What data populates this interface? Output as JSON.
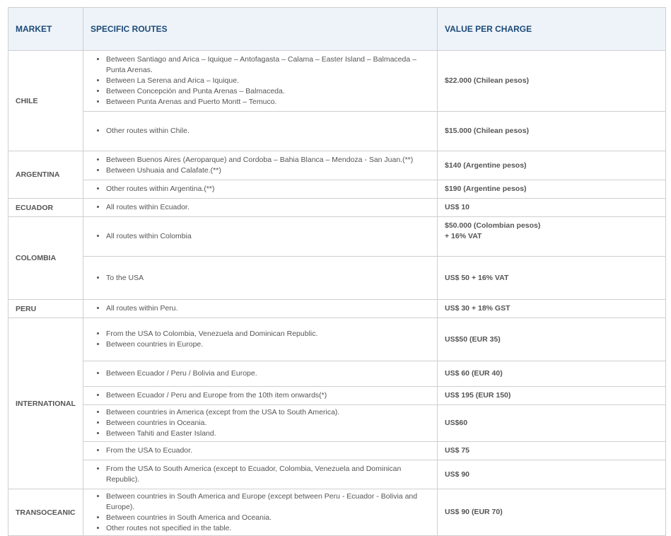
{
  "table": {
    "headers": {
      "market": "MARKET",
      "routes": "SPECIFIC ROUTES",
      "value": "VALUE PER CHARGE"
    },
    "markets": [
      {
        "name": "CHILE",
        "groups": [
          {
            "routes": [
              "Between Santiago and Arica – Iquique – Antofagasta – Calama – Easter Island – Balmaceda – Punta Arenas.",
              "Between La Serena and Arica – Iquique.",
              "Between Concepción and Punta Arenas – Balmaceda.",
              "Between Punta Arenas and Puerto Montt – Temuco."
            ],
            "value": [
              "$22.000 (Chilean pesos)"
            ]
          },
          {
            "routes": [
              "Other routes within Chile."
            ],
            "value": [
              "$15.000 (Chilean pesos)"
            ]
          }
        ]
      },
      {
        "name": "ARGENTINA",
        "groups": [
          {
            "routes": [
              "Between Buenos Aires (Aeroparque) and Cordoba – Bahia Blanca – Mendoza - San Juan.(**)",
              "Between Ushuaia and Calafate.(**)"
            ],
            "value": [
              "$140 (Argentine pesos)"
            ]
          },
          {
            "routes": [
              "Other routes within Argentina.(**)"
            ],
            "value": [
              "$190 (Argentine pesos)"
            ]
          }
        ]
      },
      {
        "name": "ECUADOR",
        "groups": [
          {
            "routes": [
              "All routes within Ecuador."
            ],
            "value": [
              "US$ 10"
            ]
          }
        ]
      },
      {
        "name": "COLOMBIA",
        "groups": [
          {
            "routes": [
              "All routes within Colombia"
            ],
            "value": [
              "$50.000 (Colombian pesos)",
              "+ 16% VAT"
            ]
          },
          {
            "routes": [
              "To the USA"
            ],
            "value": [
              "US$ 50 + 16% VAT"
            ]
          }
        ]
      },
      {
        "name": "PERU",
        "groups": [
          {
            "routes": [
              "All routes within Peru."
            ],
            "value": [
              "US$ 30 + 18% GST"
            ]
          }
        ]
      },
      {
        "name": "INTERNATIONAL",
        "groups": [
          {
            "routes": [
              "From the USA to Colombia, Venezuela and Dominican Republic.",
              "Between countries in Europe."
            ],
            "value": [
              "US$50 (EUR 35)"
            ]
          },
          {
            "routes": [
              "Between Ecuador / Peru / Bolivia and Europe."
            ],
            "value": [
              "US$ 60  (EUR 40)"
            ]
          },
          {
            "routes": [
              "Between Ecuador / Peru and Europe from the 10th item onwards(*)"
            ],
            "value": [
              "US$ 195 (EUR 150)"
            ]
          },
          {
            "routes": [
              "Between countries in America (except from the USA to South America).",
              "Between countries in Oceania.",
              "Between Tahiti and Easter Island."
            ],
            "value": [
              "US$60"
            ]
          },
          {
            "routes": [
              "From the USA to Ecuador."
            ],
            "value": [
              "US$ 75"
            ]
          },
          {
            "routes": [
              "From the USA to South America (except to Ecuador, Colombia, Venezuela and Dominican Republic)."
            ],
            "value": [
              "US$ 90"
            ]
          }
        ]
      },
      {
        "name": "TRANSOCEANIC",
        "groups": [
          {
            "routes": [
              "Between countries in South America and Europe (except between Peru - Ecuador - Bolivia and Europe).",
              "Between countries in South America and Oceania.",
              "Other routes not specified in the table."
            ],
            "value": [
              "US$ 90 (EUR 70)"
            ]
          }
        ]
      }
    ]
  }
}
